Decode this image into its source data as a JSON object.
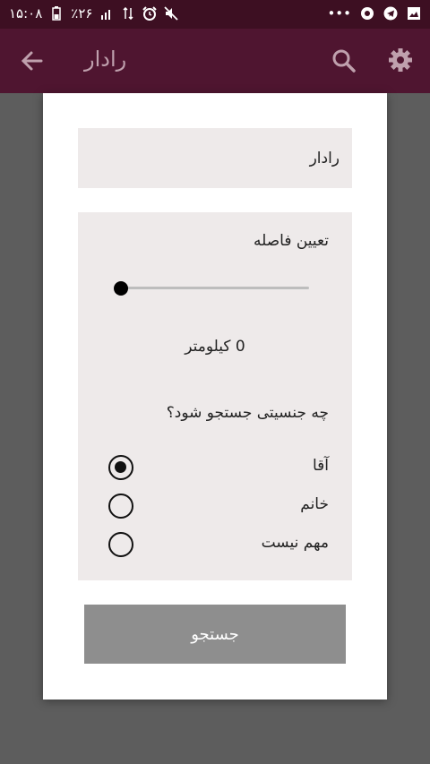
{
  "status_bar": {
    "time": "۱۵:۰۸",
    "battery_percent": "٪۲۶",
    "icons": [
      "battery-icon",
      "signal-icon",
      "data-icon",
      "alarm-icon",
      "mute-icon",
      "more-dots-icon",
      "app-icon-1",
      "telegram-icon",
      "gallery-icon"
    ],
    "more": "•••"
  },
  "app_bar": {
    "title": "رادار",
    "icons": [
      "back-arrow-icon",
      "search-icon",
      "gear-icon"
    ]
  },
  "dialog": {
    "name_field": {
      "value": "رادار"
    },
    "distance": {
      "label": "تعیین فاصله",
      "value": 0,
      "value_text": "0 کیلومتر"
    },
    "gender": {
      "question": "چه جنسیتی جستجو شود؟",
      "options": [
        {
          "label": "آقا",
          "checked": true
        },
        {
          "label": "خانم",
          "checked": false
        },
        {
          "label": "مهم نیست",
          "checked": false
        }
      ]
    },
    "search_button_label": "جستجو"
  },
  "colors": {
    "status_bar": "#3d0f22",
    "app_bar": "#4f1530",
    "overlay": "#5d5d5d",
    "panel": "#eeeaea",
    "button": "#8e8e8e"
  }
}
